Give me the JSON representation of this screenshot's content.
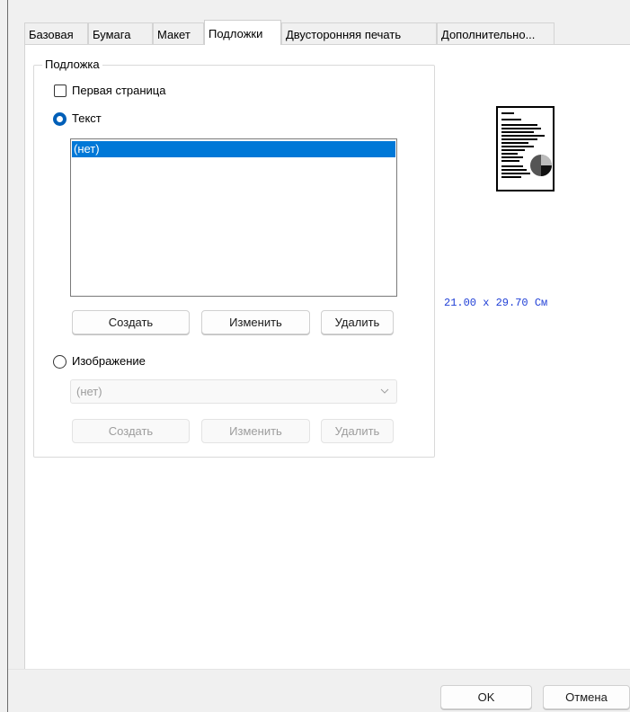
{
  "tabs": [
    {
      "label": "Базовая",
      "active": false
    },
    {
      "label": "Бумага",
      "active": false
    },
    {
      "label": "Макет",
      "active": false
    },
    {
      "label": "Подложки",
      "active": true
    },
    {
      "label": "Двусторонняя печать",
      "active": false
    },
    {
      "label": "Дополнительно..."
    }
  ],
  "group": {
    "title": "Подложка",
    "first_page": {
      "label": "Первая страница",
      "checked": false
    },
    "text_option": {
      "label": "Текст",
      "selected": true
    },
    "text_list": {
      "items": [
        "(нет)"
      ],
      "selected_index": 0
    },
    "text_buttons": {
      "create": "Создать",
      "edit": "Изменить",
      "delete": "Удалить"
    },
    "image_option": {
      "label": "Изображение",
      "selected": false
    },
    "image_select": {
      "value": "(нет)"
    },
    "image_buttons": {
      "create": "Создать",
      "edit": "Изменить",
      "delete": "Удалить"
    }
  },
  "preview": {
    "paper_size": "21.00 x 29.70 Cм"
  },
  "footer": {
    "ok": "OK",
    "cancel": "Отмена"
  },
  "colors": {
    "accent": "#0078d7",
    "radio": "#005fb8",
    "paper_size_text": "#1f3fd6"
  }
}
